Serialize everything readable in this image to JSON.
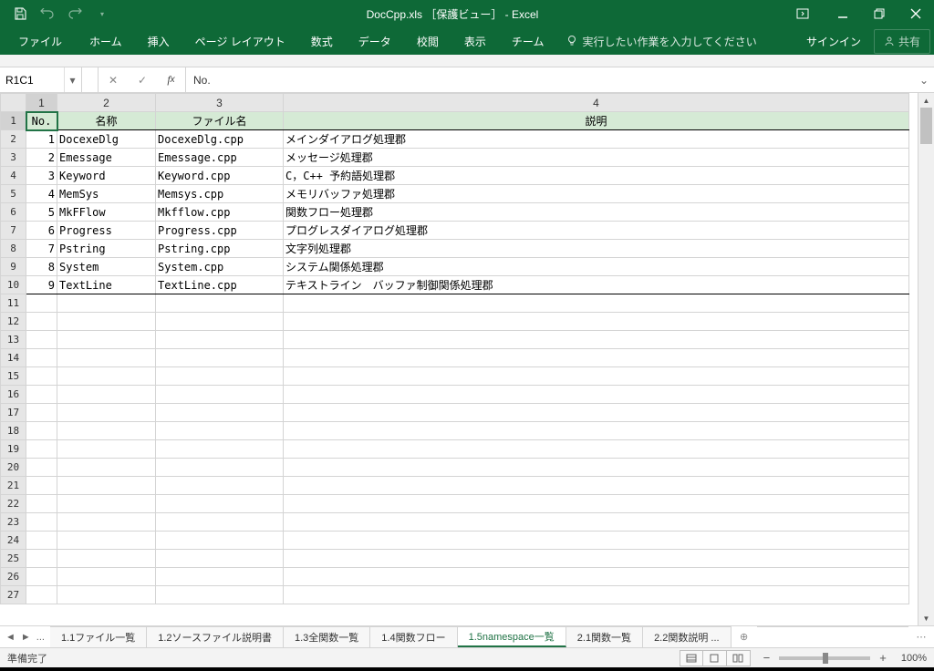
{
  "title": "DocCpp.xls ［保護ビュー］ - Excel",
  "qat": {
    "save": "save",
    "undo": "undo",
    "redo": "redo"
  },
  "win": {
    "ribbonOpts": "ribbon-display-options",
    "min": "minimize",
    "restore": "restore",
    "close": "close"
  },
  "ribbon": {
    "tabs": [
      "ファイル",
      "ホーム",
      "挿入",
      "ページ レイアウト",
      "数式",
      "データ",
      "校閲",
      "表示",
      "チーム"
    ],
    "tellMe": "実行したい作業を入力してください",
    "signIn": "サインイン",
    "share": "共有"
  },
  "nameBox": "R1C1",
  "formula": "No.",
  "colHeaders": [
    "1",
    "2",
    "3",
    "4"
  ],
  "rowCount": 27,
  "header": {
    "no": "No.",
    "name": "名称",
    "file": "ファイル名",
    "desc": "説明"
  },
  "rows": [
    {
      "no": "1",
      "name": "DocexeDlg",
      "file": "DocexeDlg.cpp",
      "desc": "メインダイアログ処理郡"
    },
    {
      "no": "2",
      "name": "Emessage",
      "file": "Emessage.cpp",
      "desc": "メッセージ処理郡"
    },
    {
      "no": "3",
      "name": "Keyword",
      "file": "Keyword.cpp",
      "desc": "C，C++ 予約語処理郡"
    },
    {
      "no": "4",
      "name": "MemSys",
      "file": "Memsys.cpp",
      "desc": "メモリバッファ処理郡"
    },
    {
      "no": "5",
      "name": "MkFFlow",
      "file": "Mkfflow.cpp",
      "desc": "関数フロー処理郡"
    },
    {
      "no": "6",
      "name": "Progress",
      "file": "Progress.cpp",
      "desc": "プログレスダイアログ処理郡"
    },
    {
      "no": "7",
      "name": "Pstring",
      "file": "Pstring.cpp",
      "desc": "文字列処理郡"
    },
    {
      "no": "8",
      "name": "System",
      "file": "System.cpp",
      "desc": "システム関係処理郡"
    },
    {
      "no": "9",
      "name": "TextLine",
      "file": "TextLine.cpp",
      "desc": "テキストライン　バッファ制御関係処理郡"
    }
  ],
  "sheets": {
    "list": [
      "1.1ファイル一覧",
      "1.2ソースファイル説明書",
      "1.3全関数一覧",
      "1.4関数フロー",
      "1.5namespace一覧",
      "2.1関数一覧",
      "2.2関数説明 ..."
    ],
    "active": 4
  },
  "status": {
    "ready": "準備完了",
    "zoom": "100%"
  }
}
